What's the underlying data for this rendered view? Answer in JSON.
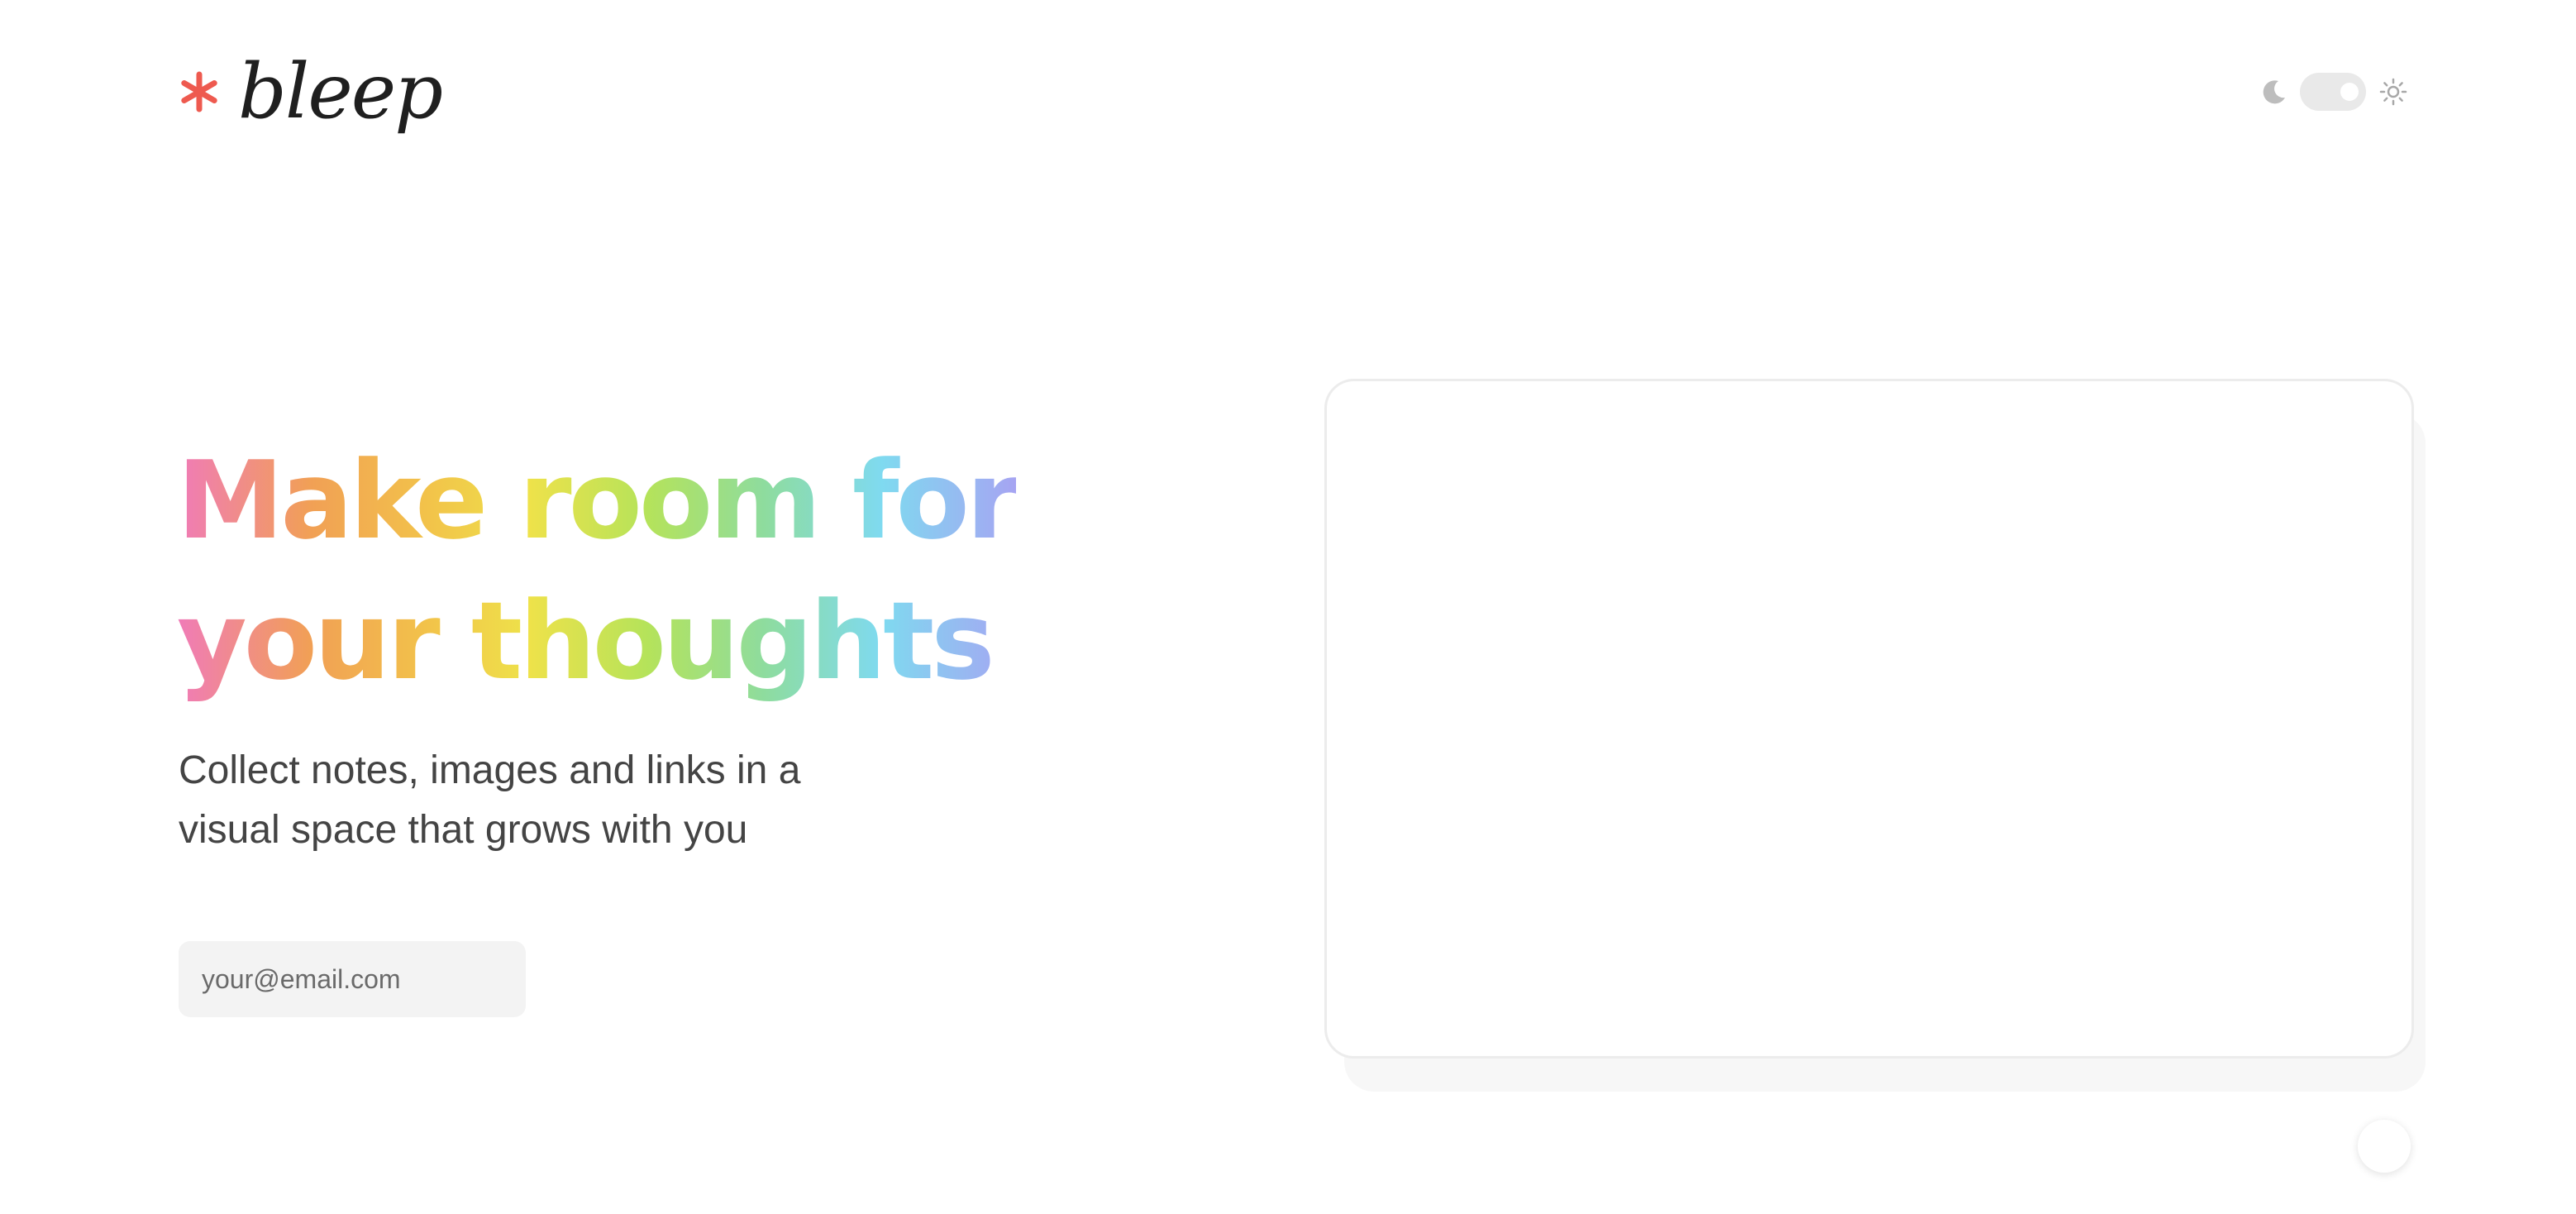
{
  "brand": {
    "name": "bleep",
    "icon": "asterisk-icon",
    "accent_color": "#ee5a4f"
  },
  "theme_toggle": {
    "left_icon": "moon-icon",
    "right_icon": "sun-icon",
    "state": "light"
  },
  "hero": {
    "headline_line1": "Make room for",
    "headline_line2": "your thoughts",
    "subtext_line1": "Collect notes, images and links in a",
    "subtext_line2": "visual space that grows with you",
    "gradient_colors": [
      "#f07bb8",
      "#f1a055",
      "#f2c34a",
      "#eee24a",
      "#b5e35a",
      "#8edc9e",
      "#7fdaf0",
      "#a6a4f2"
    ]
  },
  "signup": {
    "email_placeholder": "your@email.com",
    "email_value": ""
  },
  "preview": {
    "fab_icon": "circle-button"
  }
}
